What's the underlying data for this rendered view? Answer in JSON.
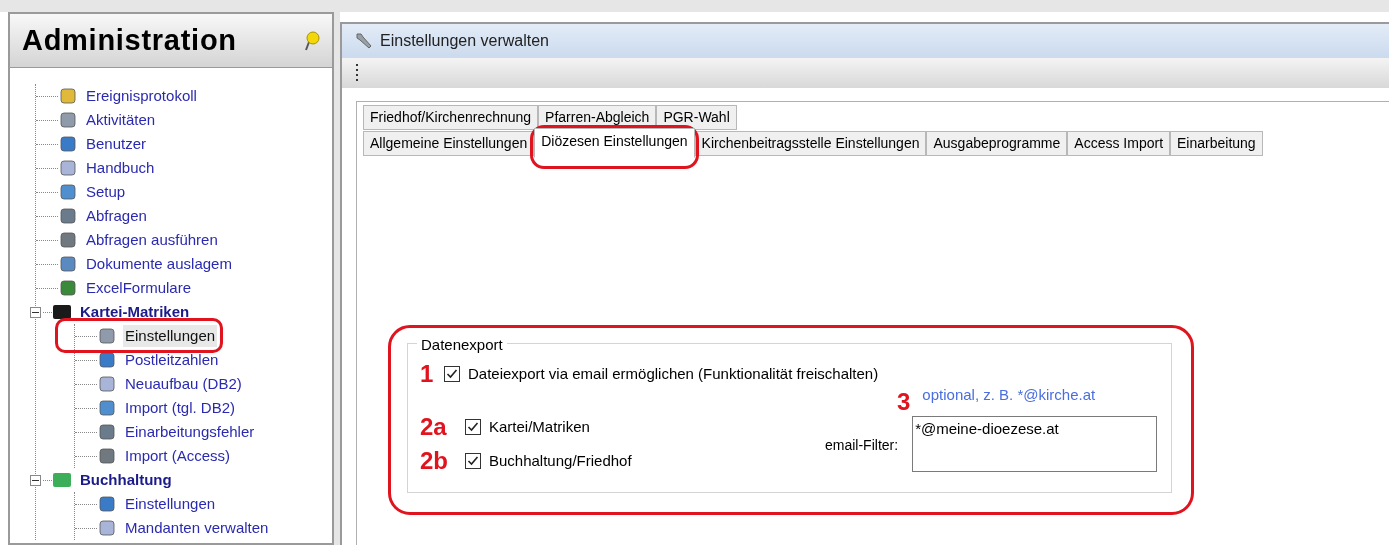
{
  "sidebar": {
    "title": "Administration",
    "tree": [
      {
        "label": "Ereignisprotokoll",
        "selected": false
      },
      {
        "label": "Aktivitäten",
        "selected": false
      },
      {
        "label": "Benutzer",
        "selected": false
      },
      {
        "label": "Handbuch",
        "selected": false
      },
      {
        "label": "Setup",
        "selected": false
      },
      {
        "label": "Abfragen",
        "selected": false
      },
      {
        "label": "Abfragen ausführen",
        "selected": false
      },
      {
        "label": "Dokumente auslagem",
        "selected": false
      },
      {
        "label": "ExcelFormulare",
        "selected": false
      },
      {
        "label": "Kartei-Matriken",
        "selected": false,
        "expanded": true,
        "children": [
          {
            "label": "Einstellungen",
            "selected": true
          },
          {
            "label": "Postleitzahlen",
            "selected": false
          },
          {
            "label": "Neuaufbau (DB2)",
            "selected": false
          },
          {
            "label": "Import (tgl. DB2)",
            "selected": false
          },
          {
            "label": "Einarbeitungsfehler",
            "selected": false
          },
          {
            "label": "Import (Access)",
            "selected": false
          }
        ]
      },
      {
        "label": "Buchhaltung",
        "selected": false,
        "expanded": true,
        "children": [
          {
            "label": "Einstellungen",
            "selected": false
          },
          {
            "label": "Mandanten verwalten",
            "selected": false
          }
        ]
      }
    ]
  },
  "main": {
    "title": "Einstellungen verwalten",
    "tab_rows": [
      [
        {
          "label": "Friedhof/Kirchenrechnung",
          "selected": false
        },
        {
          "label": "Pfarren-Abgleich",
          "selected": false
        },
        {
          "label": "PGR-Wahl",
          "selected": false
        }
      ],
      [
        {
          "label": "Allgemeine Einstellungen",
          "selected": false
        },
        {
          "label": "Diözesen Einstellungen",
          "selected": true
        },
        {
          "label": "Kirchenbeitragsstelle Einstellungen",
          "selected": false
        },
        {
          "label": "Ausgabeprogramme",
          "selected": false
        },
        {
          "label": "Access Import",
          "selected": false
        },
        {
          "label": "Einarbeitung",
          "selected": false
        }
      ]
    ],
    "group": {
      "title": "Datenexport",
      "main_option": {
        "marker": "1",
        "label": "Dateiexport via email ermöglichen (Funktionalität freischalten)",
        "checked": true
      },
      "options": [
        {
          "marker": "2a",
          "label": "Kartei/Matriken",
          "checked": true
        },
        {
          "marker": "2b",
          "label": "Buchhaltung/Friedhof",
          "checked": true
        }
      ],
      "filter": {
        "marker": "3",
        "hint": "optional, z. B. *@kirche.at",
        "label": "email-Filter:",
        "value": "*@meine-dioezese.at"
      }
    }
  }
}
